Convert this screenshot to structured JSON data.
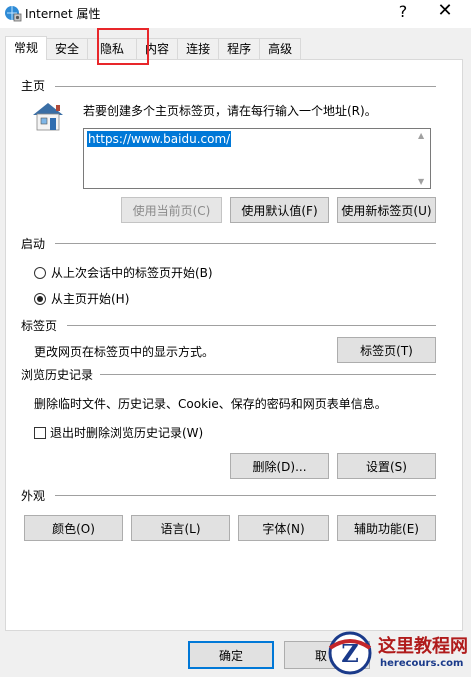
{
  "window": {
    "title": "Internet 属性",
    "help": "?",
    "close": "✕"
  },
  "tabs": [
    {
      "label": "常规",
      "active": true
    },
    {
      "label": "安全",
      "active": false
    },
    {
      "label": "隐私",
      "active": false
    },
    {
      "label": "内容",
      "active": false
    },
    {
      "label": "连接",
      "active": false
    },
    {
      "label": "程序",
      "active": false
    },
    {
      "label": "高级",
      "active": false
    }
  ],
  "homepage": {
    "section": "主页",
    "instruction": "若要创建多个主页标签页，请在每行输入一个地址(R)。",
    "url": "https://www.baidu.com/",
    "buttons": {
      "use_current": "使用当前页(C)",
      "use_default": "使用默认值(F)",
      "use_new_tab": "使用新标签页(U)"
    }
  },
  "startup": {
    "section": "启动",
    "option_last_session": "从上次会话中的标签页开始(B)",
    "option_homepage": "从主页开始(H)",
    "selected": "homepage"
  },
  "tabs_section": {
    "section": "标签页",
    "description": "更改网页在标签页中的显示方式。",
    "button": "标签页(T)"
  },
  "history": {
    "section": "浏览历史记录",
    "description": "删除临时文件、历史记录、Cookie、保存的密码和网页表单信息。",
    "checkbox_label": "退出时删除浏览历史记录(W)",
    "checked": false,
    "delete_button": "删除(D)...",
    "settings_button": "设置(S)"
  },
  "appearance": {
    "section": "外观",
    "colors": "颜色(O)",
    "languages": "语言(L)",
    "fonts": "字体(N)",
    "accessibility": "辅助功能(E)"
  },
  "footer": {
    "ok": "确定",
    "cancel": "取"
  },
  "watermark": {
    "line1": "这里教程网",
    "line2": "herecours.com"
  },
  "colors": {
    "accent": "#0078d7",
    "highlight_box": "#e8262a",
    "dialog_bg": "#f0f0f0"
  }
}
